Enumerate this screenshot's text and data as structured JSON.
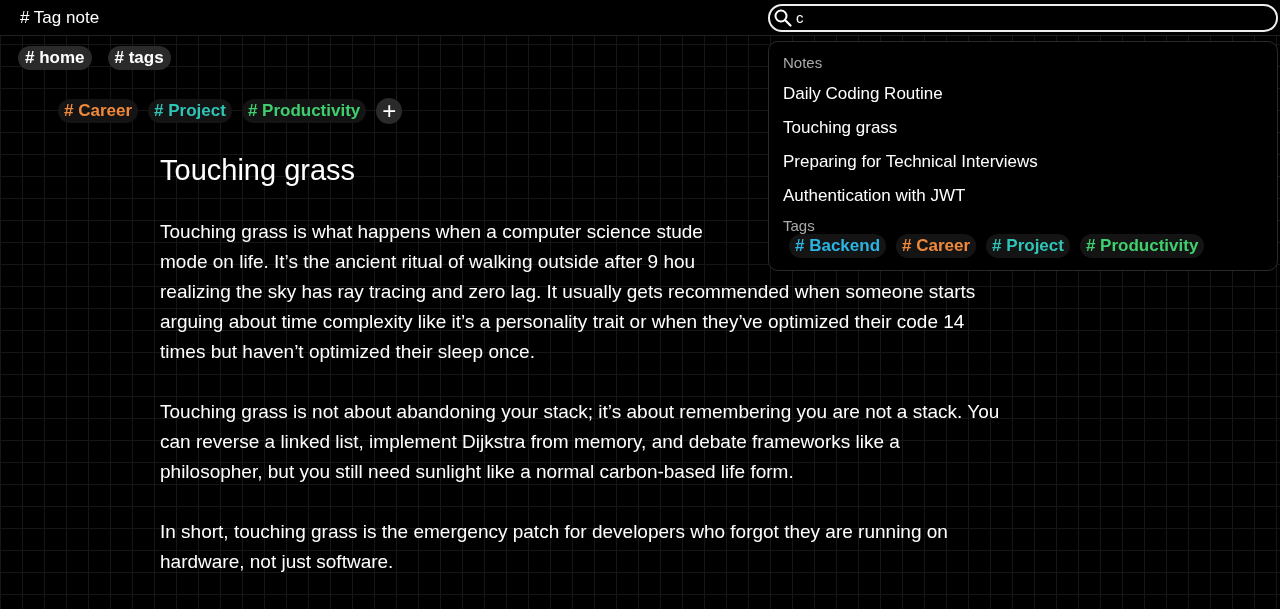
{
  "app_title": "# Tag note",
  "search": {
    "value": "c"
  },
  "breadcrumbs": [
    "# home",
    "# tags"
  ],
  "note_tags": [
    {
      "label": "# Career",
      "color": "#f0893c"
    },
    {
      "label": "# Project",
      "color": "#2ec4b6"
    },
    {
      "label": "# Productivity",
      "color": "#3fcf6f"
    }
  ],
  "add_tag": "+",
  "note": {
    "title": "Touching grass",
    "paragraphs": [
      [
        "Touching grass is what happens when a computer science stude",
        "mode on life. It’s the ancient ritual of walking outside after 9 hou",
        "realizing the sky has ray tracing and zero lag. It usually gets recommended when someone starts",
        "arguing about time complexity like it’s a personality trait or when they’ve optimized their code 14",
        "times but haven’t optimized their sleep once."
      ],
      [
        "Touching grass is not about abandoning your stack; it’s about remembering you are not a stack. You",
        "can reverse a linked list, implement Dijkstra from memory, and debate frameworks like a",
        "philosopher, but you still need sunlight like a normal carbon-based life form."
      ],
      [
        "In short, touching grass is the emergency patch for developers who forgot they are running on",
        "hardware, not just software."
      ]
    ]
  },
  "results": {
    "notes_heading": "Notes",
    "notes": [
      "Daily Coding Routine",
      "Touching grass",
      "Preparing for Technical Interviews",
      "Authentication with JWT"
    ],
    "tags_heading": "Tags",
    "tags": [
      {
        "label": "# Backend",
        "color": "#2bb5e3"
      },
      {
        "label": "# Career",
        "color": "#f0893c"
      },
      {
        "label": "# Project",
        "color": "#2ec4b6"
      },
      {
        "label": "# Productivity",
        "color": "#3fcf6f"
      }
    ]
  }
}
